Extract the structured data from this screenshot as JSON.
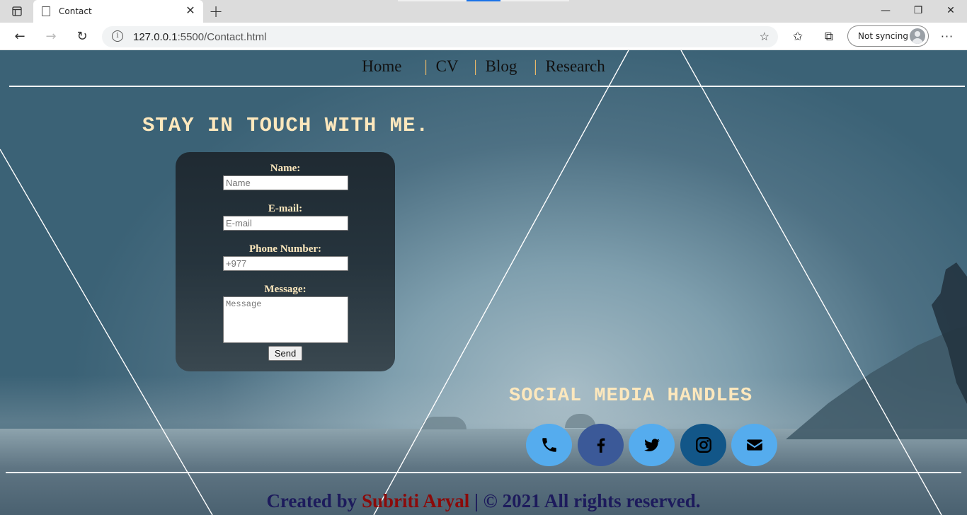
{
  "browser": {
    "tab_title": "Contact",
    "url_host": "127.0.0.1",
    "url_path": ":5500/Contact.html",
    "sync_label": "Not syncing",
    "more_icon": "more-icon"
  },
  "nav": {
    "items": [
      "Home",
      "CV",
      "Blog",
      "Research"
    ],
    "separator": "|"
  },
  "contact": {
    "heading": "STAY IN TOUCH WITH ME.",
    "name_label": "Name:",
    "name_placeholder": "Name",
    "email_label": "E-mail:",
    "email_placeholder": "E-mail",
    "phone_label": "Phone Number:",
    "phone_placeholder": "+977",
    "message_label": "Message:",
    "message_placeholder": "Message",
    "send_label": "Send"
  },
  "social": {
    "heading": "SOCIAL MEDIA HANDLES",
    "icons": [
      {
        "name": "phone-icon",
        "color": "#55acee"
      },
      {
        "name": "facebook-icon",
        "color": "#3b5998"
      },
      {
        "name": "twitter-icon",
        "color": "#55acee"
      },
      {
        "name": "instagram-icon",
        "color": "#125688"
      },
      {
        "name": "email-icon",
        "color": "#55acee"
      }
    ]
  },
  "footer": {
    "prefix": "Created by",
    "author": "Subriti Aryal",
    "suffix": "| © 2021 All rights reserved."
  },
  "colors": {
    "heading": "#fde8bd",
    "footer_text": "#1d1b5c",
    "footer_author": "#8b0a0a",
    "nav_separator": "#e8b86a"
  }
}
